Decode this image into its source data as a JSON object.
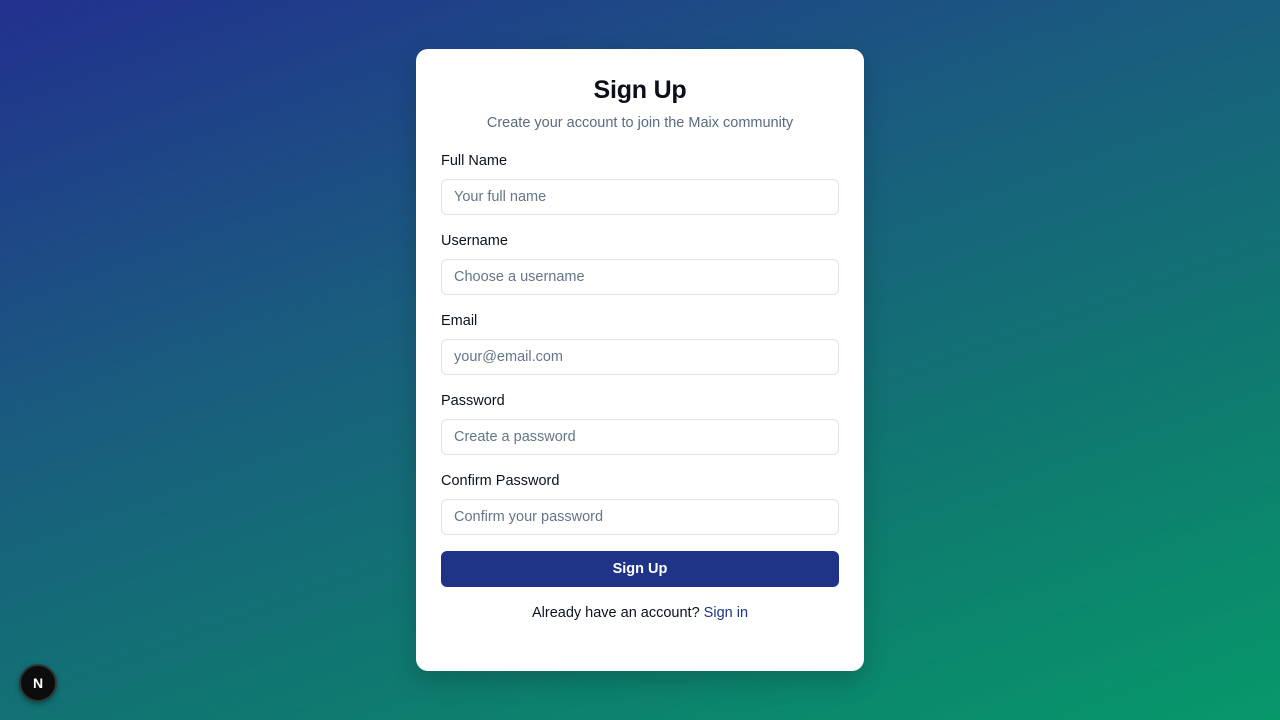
{
  "signup": {
    "title": "Sign Up",
    "subtitle": "Create your account to join the Maix community",
    "fields": [
      {
        "label": "Full Name",
        "placeholder": "Your full name",
        "value": ""
      },
      {
        "label": "Username",
        "placeholder": "Choose a username",
        "value": ""
      },
      {
        "label": "Email",
        "placeholder": "your@email.com",
        "value": ""
      },
      {
        "label": "Password",
        "placeholder": "Create a password",
        "value": ""
      },
      {
        "label": "Confirm Password",
        "placeholder": "Confirm your password",
        "value": ""
      }
    ],
    "submit_label": "Sign Up",
    "footer_text": "Already have an account?",
    "signin_link": "Sign in"
  },
  "dev_badge": {
    "icon": "nextjs-n-icon",
    "glyph": "N"
  },
  "colors": {
    "primary": "#1f3487",
    "background_start": "#22308e",
    "background_end": "#07986a",
    "card": "#ffffff",
    "muted_text": "#5b6b7f"
  }
}
